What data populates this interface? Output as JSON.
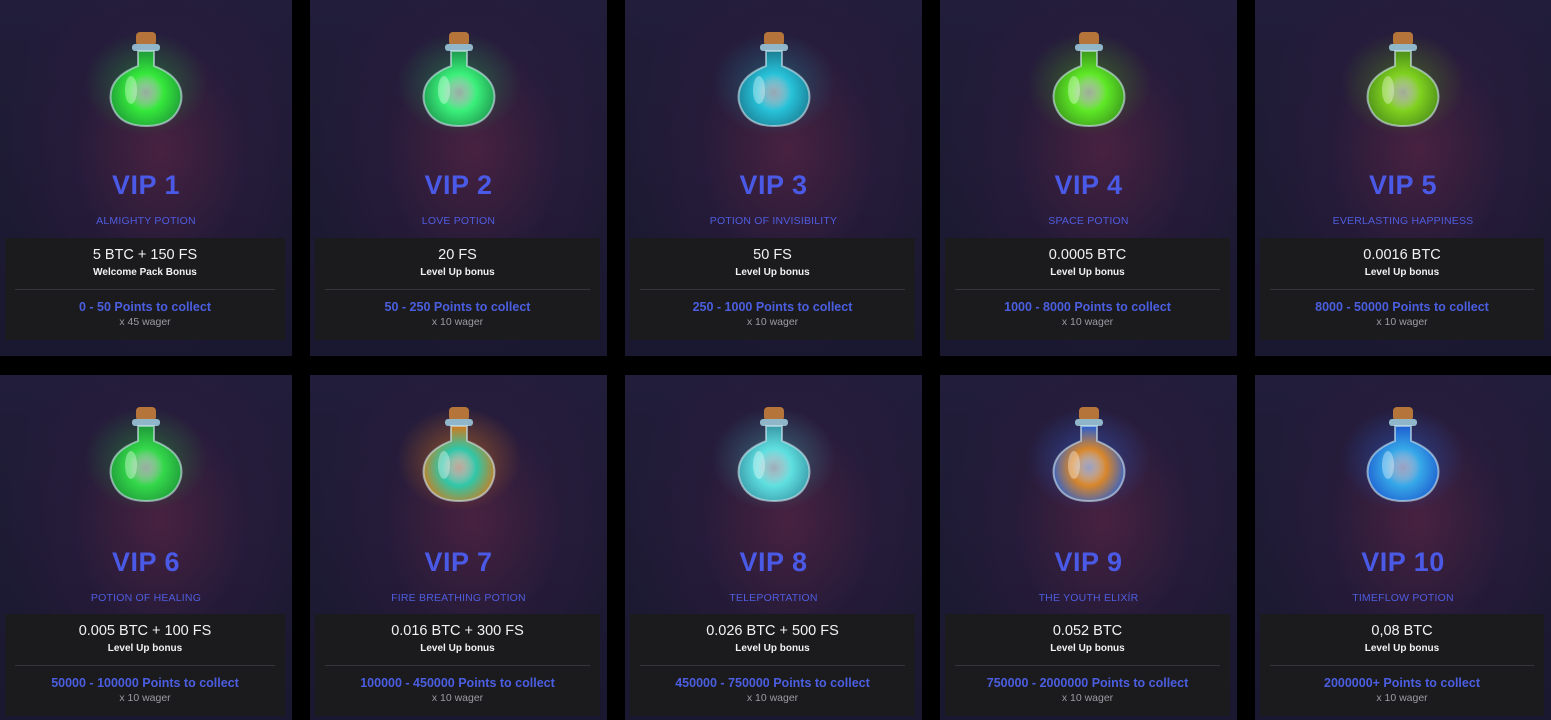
{
  "tiers": [
    {
      "level": "VIP 1",
      "name": "ALMIGHTY POTION",
      "bonus": "5 BTC + 150 FS",
      "bonus_type": "Welcome Pack Bonus",
      "points": "0 - 50 Points to collect",
      "wager": "x 45 wager",
      "potion_icon": "green-vial-potion-icon",
      "liquid": "#35e83a",
      "glow": "#1f9a3a"
    },
    {
      "level": "VIP 2",
      "name": "LOVE POTION",
      "bonus": "20 FS",
      "bonus_type": "Level Up bonus",
      "points": "50 - 250 Points to collect",
      "wager": "x 10 wager",
      "potion_icon": "green-flask-potion-icon",
      "liquid": "#3af07a",
      "glow": "#1f9a50"
    },
    {
      "level": "VIP 3",
      "name": "POTION OF INVISIBILITY",
      "bonus": "50 FS",
      "bonus_type": "Level Up bonus",
      "points": "250 - 1000 Points to collect",
      "wager": "x 10 wager",
      "potion_icon": "teal-pouch-potion-icon",
      "liquid": "#27c2d9",
      "glow": "#1b7f95"
    },
    {
      "level": "VIP 4",
      "name": "SPACE POTION",
      "bonus": "0.0005 BTC",
      "bonus_type": "Level Up bonus",
      "points": "1000 - 8000 Points to collect",
      "wager": "x 10 wager",
      "potion_icon": "lime-round-potion-icon",
      "liquid": "#5ee826",
      "glow": "#3c9a1c"
    },
    {
      "level": "VIP 5",
      "name": "EVERLASTING HAPPINESS",
      "bonus": "0.0016 BTC",
      "bonus_type": "Level Up bonus",
      "points": "8000 - 50000 Points to collect",
      "wager": "x 10 wager",
      "potion_icon": "olive-round-potion-icon",
      "liquid": "#7fd11f",
      "glow": "#4e8f1a"
    },
    {
      "level": "VIP 6",
      "name": "POTION OF HEALING",
      "bonus": "0.005 BTC + 100 FS",
      "bonus_type": "Level Up bonus",
      "points": "50000 - 100000 Points to collect",
      "wager": "x 10 wager",
      "potion_icon": "green-cone-potion-icon",
      "liquid": "#34d84a",
      "glow": "#1f9a3a"
    },
    {
      "level": "VIP 7",
      "name": "FIRE BREATHING POTION",
      "bonus": "0.016 BTC + 300 FS",
      "bonus_type": "Level Up bonus",
      "points": "100000 - 450000 Points to collect",
      "wager": "x 10 wager",
      "potion_icon": "crystal-fire-potion-icon",
      "liquid": "#2fc7a8",
      "glow": "#d07a1c"
    },
    {
      "level": "VIP 8",
      "name": "TELEPORTATION",
      "bonus": "0.026 BTC + 500 FS",
      "bonus_type": "Level Up bonus",
      "points": "450000 - 750000 Points to collect",
      "wager": "x 10 wager",
      "potion_icon": "cyan-sack-potion-icon",
      "liquid": "#5fe0e0",
      "glow": "#3a9aa8"
    },
    {
      "level": "VIP 9",
      "name": "THE YOUTH ELIXÍR",
      "bonus": "0.052 BTC",
      "bonus_type": "Level Up bonus",
      "points": "750000 - 2000000 Points to collect",
      "wager": "x 10 wager",
      "potion_icon": "amber-scroll-potion-icon",
      "liquid": "#d8862a",
      "glow": "#2a5fd0"
    },
    {
      "level": "VIP 10",
      "name": "TIMEFLOW POTION",
      "bonus": "0,08 BTC",
      "bonus_type": "Level Up bonus",
      "points": "2000000+ Points to collect",
      "wager": "x 10 wager",
      "potion_icon": "blue-golden-potion-icon",
      "liquid": "#36a8e8",
      "glow": "#1f5fd0"
    }
  ]
}
